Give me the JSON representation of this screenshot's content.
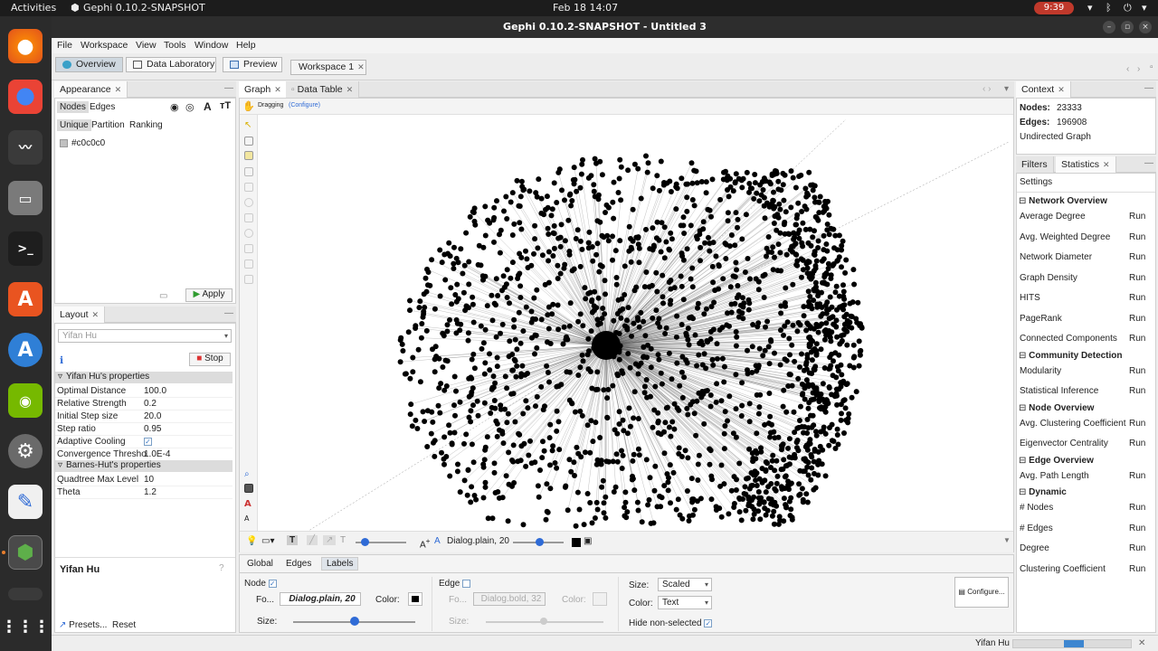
{
  "topbar": {
    "activities": "Activities",
    "app_name": "Gephi 0.10.2-SNAPSHOT",
    "datetime": "Feb 18  14:07",
    "battery": "9:39"
  },
  "window": {
    "title": "Gephi 0.10.2-SNAPSHOT - Untitled 3"
  },
  "menu": [
    "File",
    "Workspace",
    "View",
    "Tools",
    "Window",
    "Help"
  ],
  "modes": {
    "overview": "Overview",
    "data_lab": "Data Laboratory",
    "preview": "Preview"
  },
  "workspace_tab": "Workspace 1",
  "appearance": {
    "title": "Appearance",
    "tabs": {
      "nodes": "Nodes",
      "edges": "Edges"
    },
    "subtabs": {
      "unique": "Unique",
      "partition": "Partition",
      "ranking": "Ranking"
    },
    "color_value": "#c0c0c0",
    "apply": "Apply"
  },
  "layout": {
    "title": "Layout",
    "algorithm": "Yifan Hu",
    "stop": "Stop",
    "section1": "Yifan Hu's properties",
    "props1": [
      {
        "name": "Optimal Distance",
        "value": "100.0"
      },
      {
        "name": "Relative Strength",
        "value": "0.2"
      },
      {
        "name": "Initial Step size",
        "value": "20.0"
      },
      {
        "name": "Step ratio",
        "value": "0.95"
      },
      {
        "name": "Adaptive Cooling",
        "value": "✓"
      },
      {
        "name": "Convergence Thresho",
        "value": "1.0E-4"
      }
    ],
    "section2": "Barnes-Hut's properties",
    "props2": [
      {
        "name": "Quadtree Max Level",
        "value": "10"
      },
      {
        "name": "Theta",
        "value": "1.2"
      }
    ],
    "footer_title": "Yifan Hu",
    "presets": "Presets...",
    "reset": "Reset"
  },
  "graph": {
    "tab_graph": "Graph",
    "tab_datatable": "Data Table",
    "mode": "Dragging",
    "configure": "(Configure)",
    "font_label": "Dialog.plain, 20",
    "node_color": "#000000"
  },
  "labels_panel": {
    "tabs": {
      "global": "Global",
      "edges": "Edges",
      "labels": "Labels"
    },
    "node": "Node",
    "edge": "Edge",
    "font_short": "Fo...",
    "node_font": "Dialog.plain, 20",
    "edge_font": "Dialog.bold, 32",
    "color": "Color:",
    "size": "Size:",
    "size_combo_label": "Size:",
    "size_combo_value": "Scaled",
    "color_combo_label": "Color:",
    "color_combo_value": "Text",
    "hide_non_selected": "Hide non-selected",
    "configure": "Configure..."
  },
  "context": {
    "title": "Context",
    "nodes_label": "Nodes:",
    "nodes": "23333",
    "edges_label": "Edges:",
    "edges": "196908",
    "type": "Undirected Graph"
  },
  "statistics": {
    "tab_filters": "Filters",
    "tab_statistics": "Statistics",
    "settings": "Settings",
    "run": "Run",
    "groups": [
      {
        "name": "Network Overview",
        "items": [
          "Average Degree",
          "Avg. Weighted Degree",
          "Network Diameter",
          "Graph Density",
          "HITS",
          "PageRank",
          "Connected Components"
        ]
      },
      {
        "name": "Community Detection",
        "items": [
          "Modularity",
          "Statistical Inference"
        ]
      },
      {
        "name": "Node Overview",
        "items": [
          "Avg. Clustering Coefficient",
          "Eigenvector Centrality"
        ]
      },
      {
        "name": "Edge Overview",
        "items": [
          "Avg. Path Length"
        ]
      },
      {
        "name": "Dynamic",
        "items": [
          "# Nodes",
          "# Edges",
          "Degree",
          "Clustering Coefficient"
        ]
      }
    ]
  },
  "status": {
    "task": "Yifan Hu",
    "progress": 0.6
  }
}
